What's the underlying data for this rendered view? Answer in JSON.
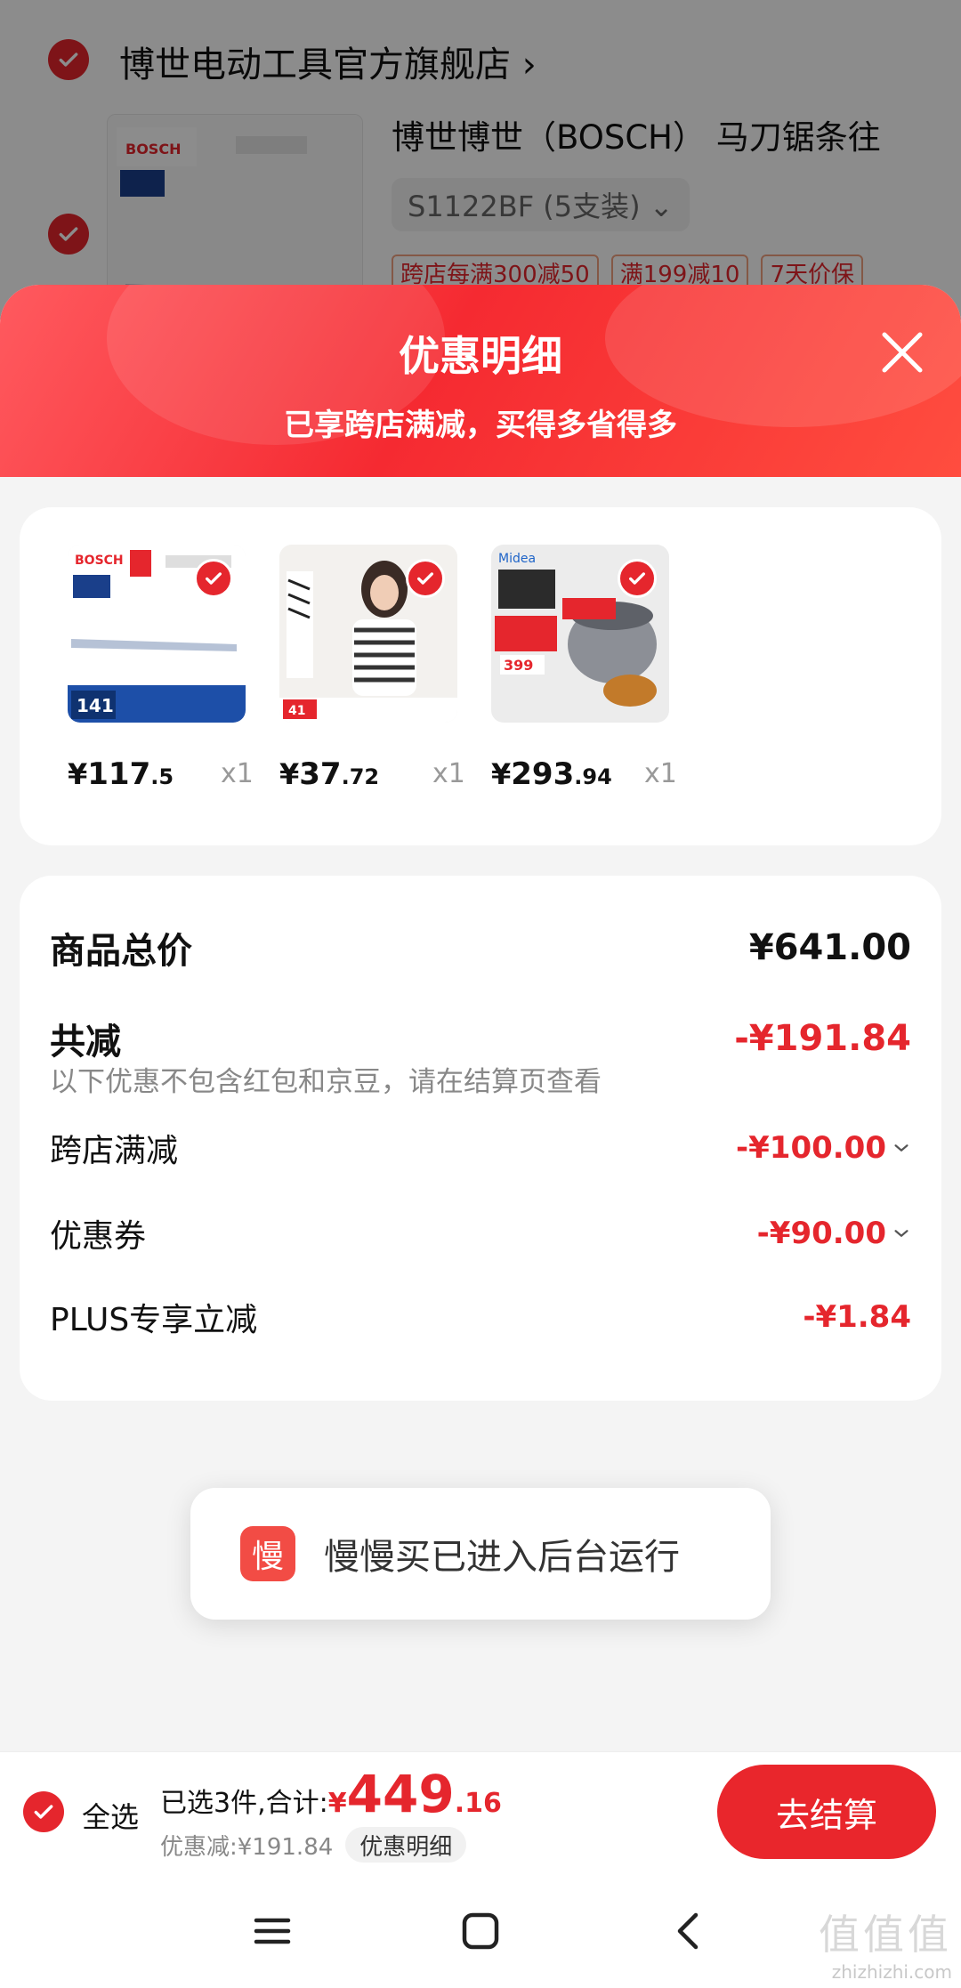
{
  "background_cart": {
    "store_name": "博世电动工具官方旗舰店 ›",
    "item_title": "博世博世（BOSCH） 马刀锯条往",
    "item_spec": "S1122BF (5支装) ⌄",
    "tags": [
      "跨店每满300减50",
      "满199减10",
      "7天价保"
    ]
  },
  "sheet": {
    "title": "优惠明细",
    "subtitle": "已享跨店满减，买得多省得多"
  },
  "products": [
    {
      "price_int": "117",
      "price_dec": ".5",
      "currency": "¥",
      "qty": "x1",
      "image": "bosch-saw-blade"
    },
    {
      "price_int": "37",
      "price_dec": ".72",
      "currency": "¥",
      "qty": "x1",
      "image": "striped-tshirt"
    },
    {
      "price_int": "293",
      "price_dec": ".94",
      "currency": "¥",
      "qty": "x1",
      "image": "midea-pressure-cooker"
    }
  ],
  "summary": {
    "total_label": "商品总价",
    "total_value": "¥641.00",
    "reduce_label": "共减",
    "reduce_value": "-¥191.84",
    "note": "以下优惠不包含红包和京豆，请在结算页查看",
    "items": [
      {
        "label": "跨店满减",
        "value": "-¥100.00"
      },
      {
        "label": "优惠券",
        "value": "-¥90.00"
      },
      {
        "label": "PLUS专享立减",
        "value": "-¥1.84"
      }
    ]
  },
  "toast": {
    "icon_text": "慢",
    "text": "慢慢买已进入后台运行"
  },
  "bottom_bar": {
    "select_all": "全选",
    "selected_text": "已选3件,合计:",
    "currency": "¥",
    "total_int": "449",
    "total_dec": ".16",
    "discount_text": "优惠减:¥191.84",
    "detail_label": "优惠明细",
    "checkout_label": "去结算"
  },
  "watermark": {
    "logo": "值值值",
    "site": "zhizhizhi.com"
  },
  "colors": {
    "accent": "#e5262d",
    "header_gradient_start": "#ff5a5f",
    "header_gradient_end": "#f52a31"
  }
}
